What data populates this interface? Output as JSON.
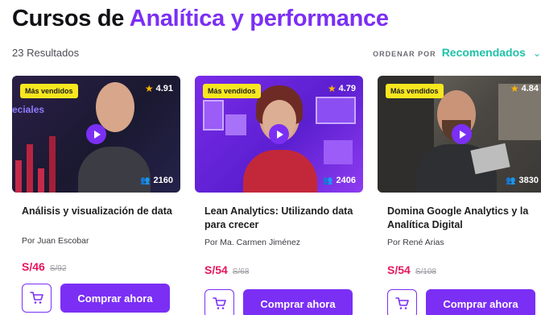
{
  "header": {
    "title_prefix": "Cursos de ",
    "title_accent": "Analítica y performance"
  },
  "results": "23 Resultados",
  "sort": {
    "label": "ORDENAR POR",
    "value": "Recomendados"
  },
  "colors": {
    "accent": "#7b2ff5",
    "price": "#e6175c",
    "sort": "#1ec2a8",
    "badge": "#f7e71f"
  },
  "courses": [
    {
      "badge": "Más vendidos",
      "rating": "4.91",
      "students": "2160",
      "thumb_text": "eciales",
      "title": "Análisis y visualización de data",
      "author": "Por Juan Escobar",
      "price": "S/46",
      "old_price": "S/92",
      "buy_label": "Comprar ahora"
    },
    {
      "badge": "Más vendidos",
      "rating": "4.79",
      "students": "2406",
      "title": "Lean Analytics: Utilizando data para crecer",
      "author": "Por Ma. Carmen Jiménez",
      "price": "S/54",
      "old_price": "S/68",
      "buy_label": "Comprar ahora"
    },
    {
      "badge": "Más vendidos",
      "rating": "4.84",
      "students": "3830",
      "title": "Domina Google Analytics y la Analítica Digital",
      "author": "Por René Arias",
      "price": "S/54",
      "old_price": "S/108",
      "buy_label": "Comprar ahora"
    }
  ]
}
